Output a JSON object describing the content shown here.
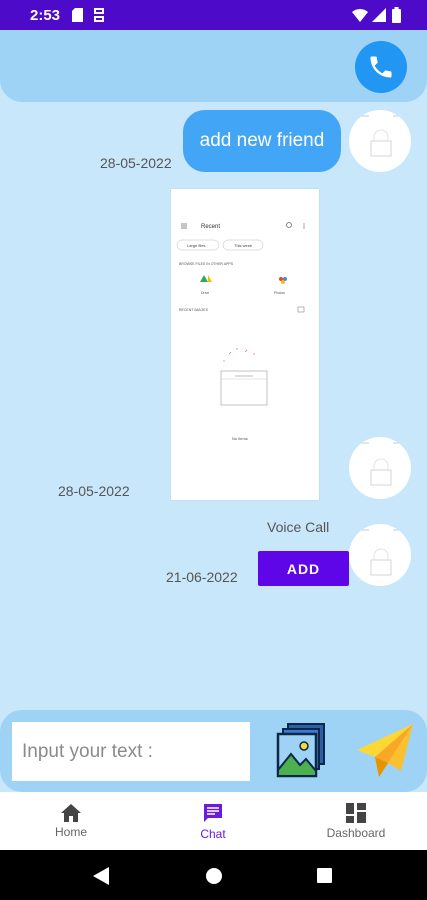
{
  "status_bar": {
    "time": "2:53"
  },
  "header": {
    "call_icon": "phone-icon"
  },
  "messages": [
    {
      "type": "text",
      "text": "add new friend",
      "timestamp": "28-05-2022"
    },
    {
      "type": "image",
      "timestamp": "28-05-2022"
    },
    {
      "type": "voice_call",
      "label": "Voice Call",
      "button": "ADD",
      "timestamp": "21-06-2022"
    }
  ],
  "input": {
    "placeholder": "Input your text :"
  },
  "nav": {
    "items": [
      {
        "label": "Home",
        "icon": "home-icon"
      },
      {
        "label": "Chat",
        "icon": "chat-icon",
        "active": true
      },
      {
        "label": "Dashboard",
        "icon": "dashboard-icon"
      }
    ]
  },
  "colors": {
    "status": "#4d0ac8",
    "accent": "#6a1be0",
    "bubble": "#42a5f5",
    "background": "#c9e7fb"
  },
  "shared_screenshot": {
    "title": "Recent",
    "chips": [
      "Large files",
      "This week"
    ],
    "section1": "BROWSE FILES IN OTHER APPS",
    "apps": [
      "Drive",
      "Photos"
    ],
    "section2": "RECENT IMAGES",
    "empty": "No items"
  }
}
